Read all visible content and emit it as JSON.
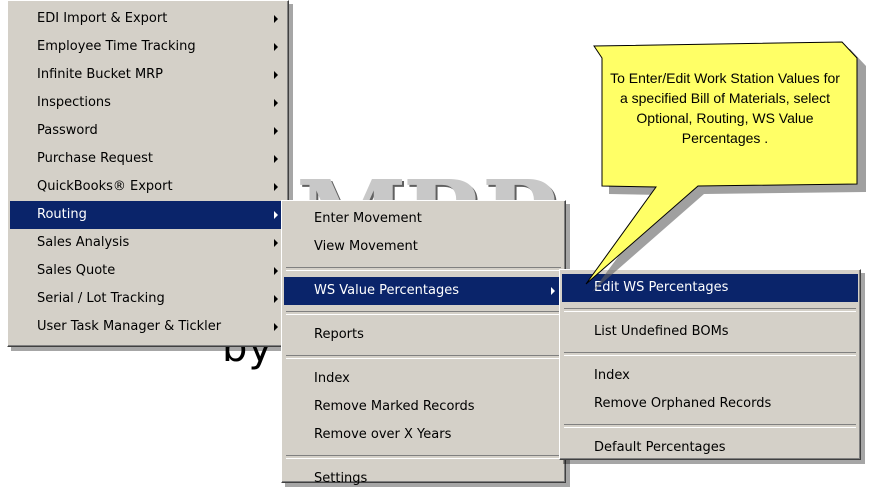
{
  "background": {
    "logo_text": "MRP",
    "by_text": "by"
  },
  "menu_main": {
    "items": [
      {
        "label": "EDI Import & Export",
        "has_submenu": true
      },
      {
        "label": "Employee Time Tracking",
        "has_submenu": true
      },
      {
        "label": "Infinite Bucket MRP",
        "has_submenu": true
      },
      {
        "label": "Inspections",
        "has_submenu": true
      },
      {
        "label": "Password",
        "has_submenu": true
      },
      {
        "label": "Purchase Request",
        "has_submenu": true
      },
      {
        "label": "QuickBooks® Export",
        "has_submenu": true
      },
      {
        "label": "Routing",
        "has_submenu": true,
        "selected": true
      },
      {
        "label": "Sales Analysis",
        "has_submenu": true
      },
      {
        "label": "Sales Quote",
        "has_submenu": true
      },
      {
        "label": "Serial / Lot Tracking",
        "has_submenu": true
      },
      {
        "label": "User Task Manager & Tickler",
        "has_submenu": true
      }
    ]
  },
  "menu_routing": {
    "items": [
      {
        "label": "Enter  Movement"
      },
      {
        "label": "View  Movement"
      },
      {
        "label": "WS Value Percentages",
        "has_submenu": true,
        "selected": true
      },
      {
        "label": "Reports"
      },
      {
        "label": "Index"
      },
      {
        "label": "Remove Marked Records"
      },
      {
        "label": "Remove over X Years"
      },
      {
        "label": "Settings"
      }
    ]
  },
  "menu_ws": {
    "items": [
      {
        "label": "Edit WS Percentages",
        "selected": true
      },
      {
        "label": "List Undefined BOMs"
      },
      {
        "label": "Index"
      },
      {
        "label": "Remove Orphaned Records"
      },
      {
        "label": "Default Percentages"
      }
    ]
  },
  "callout": {
    "text": "To Enter/Edit Work Station Values for a specified Bill of Materials, select Optional, Routing, WS Value Percentages .",
    "fill": "#ffff66"
  },
  "colors": {
    "menu_bg": "#d4d0c8",
    "selection": "#0a246a"
  }
}
